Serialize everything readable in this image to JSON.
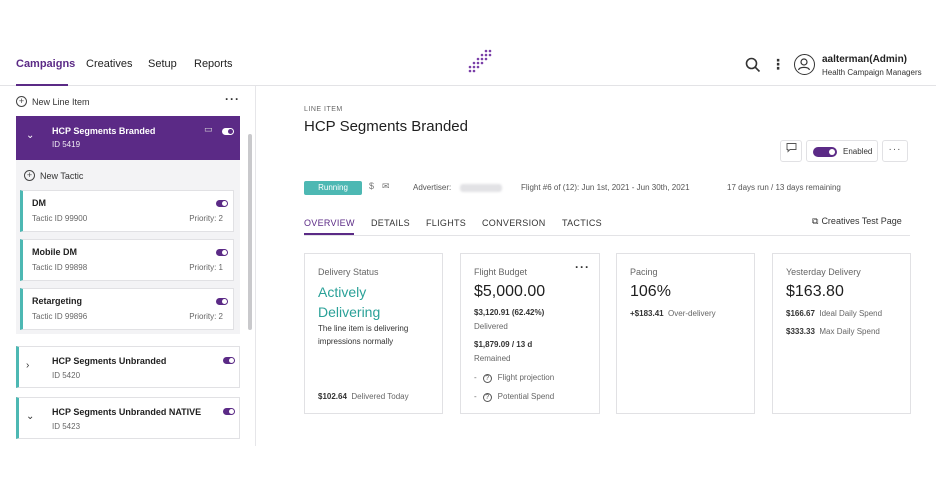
{
  "nav": {
    "tabs": [
      "Campaigns",
      "Creatives",
      "Setup",
      "Reports"
    ],
    "active_tab": "Campaigns",
    "user_name": "aalterman(Admin)",
    "user_org": "Health Campaign Managers"
  },
  "sidebar": {
    "new_line_item": "New Line Item",
    "selected_line_item": {
      "name": "HCP Segments Branded",
      "id": "ID 5419"
    },
    "new_tactic": "New Tactic",
    "tactics": [
      {
        "name": "DM",
        "id": "Tactic ID 99900",
        "priority": "Priority: 2"
      },
      {
        "name": "Mobile DM",
        "id": "Tactic ID 99898",
        "priority": "Priority: 1"
      },
      {
        "name": "Retargeting",
        "id": "Tactic ID 99896",
        "priority": "Priority: 2"
      }
    ],
    "line_items": [
      {
        "name": "HCP Segments Unbranded",
        "id": "ID 5420",
        "caret": "›"
      },
      {
        "name": "HCP Segments Unbranded NATIVE",
        "id": "ID 5423",
        "caret": "⌄"
      }
    ]
  },
  "main": {
    "eyebrow": "LINE ITEM",
    "title": "HCP Segments Branded",
    "enabled_label": "Enabled",
    "status": "Running",
    "advertiser_label": "Advertiser:",
    "flight": "Flight #6 of (12): Jun 1st, 2021 - Jun 30th, 2021",
    "days": "17 days run / 13 days remaining",
    "tabs": [
      "OVERVIEW",
      "DETAILS",
      "FLIGHTS",
      "CONVERSION",
      "TACTICS"
    ],
    "creatives_test_page": "Creatives Test Page"
  },
  "cards": {
    "delivery": {
      "label": "Delivery Status",
      "status_line1": "Actively",
      "status_line2": "Delivering",
      "desc_line1": "The line item is delivering",
      "desc_line2": "impressions normally",
      "today_value": "$102.64",
      "today_label": "Delivered Today"
    },
    "budget": {
      "label": "Flight Budget",
      "amount": "$5,000.00",
      "delivered_value": "$3,120.91 (62.42%)",
      "delivered_label": "Delivered",
      "remained_value": "$1,879.09 / 13 d",
      "remained_label": "Remained",
      "projection": "Flight projection",
      "potential": "Potential Spend"
    },
    "pacing": {
      "label": "Pacing",
      "value": "106%",
      "over_value": "+$183.41",
      "over_label": "Over-delivery"
    },
    "yesterday": {
      "label": "Yesterday Delivery",
      "value": "$163.80",
      "ideal_value": "$166.67",
      "ideal_label": "Ideal Daily Spend",
      "max_value": "$333.33",
      "max_label": "Max Daily Spend"
    }
  },
  "colors": {
    "brand": "#5b2a86",
    "teal": "#4db8b3"
  }
}
